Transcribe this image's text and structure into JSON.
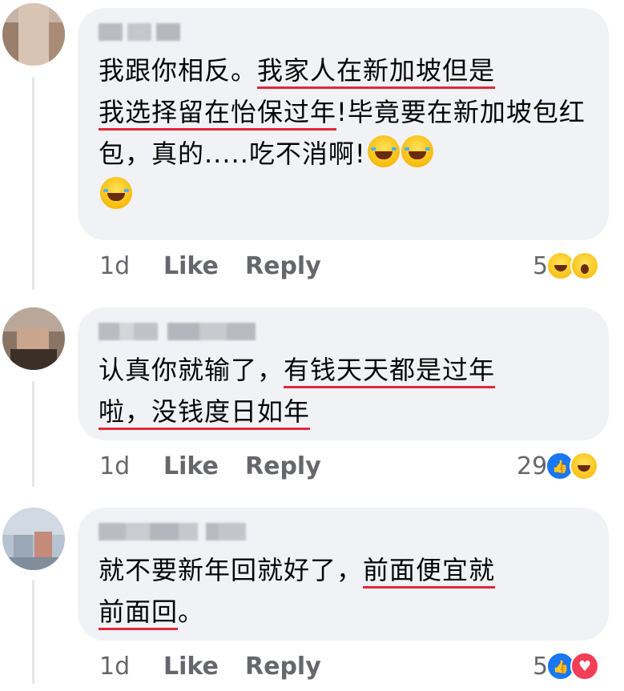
{
  "comments": [
    {
      "name": "",
      "text_plain": "我跟你相反。",
      "text_u1": "我家人在新加坡但是",
      "text_u2": "我选择留在怡保过年",
      "text_rest": "!毕竟要在新加坡包红包，真的.....吃不消啊!",
      "emojis": [
        "tears-of-joy-emoji",
        "tears-of-joy-emoji",
        "tears-of-joy-emoji"
      ],
      "age": "1d",
      "like": "Like",
      "reply": "Reply",
      "reaction_count": "5",
      "reactions": [
        "haha-reaction-icon",
        "wow-reaction-icon"
      ]
    },
    {
      "name": "",
      "text_plain": "认真你就输了，",
      "text_u1": "有钱天天都是过年",
      "text_u2": "啦，没钱度日如年",
      "age": "1d",
      "like": "Like",
      "reply": "Reply",
      "reaction_count": "29",
      "reactions": [
        "like-reaction-icon",
        "haha-reaction-icon"
      ]
    },
    {
      "name": "",
      "text_plain": "就不要新年回就好了，",
      "text_u1": "前面便宜就",
      "text_u2": "前面回",
      "text_end": "。",
      "age": "1d",
      "like": "Like",
      "reply": "Reply",
      "reaction_count": "5",
      "reactions": [
        "like-reaction-icon",
        "love-reaction-icon"
      ]
    }
  ],
  "colors": {
    "bubble": "#f0f2f5",
    "underline": "#e0283c",
    "meta": "#65676b",
    "like_blue": "#1877f2",
    "love_red": "#f33e58"
  }
}
